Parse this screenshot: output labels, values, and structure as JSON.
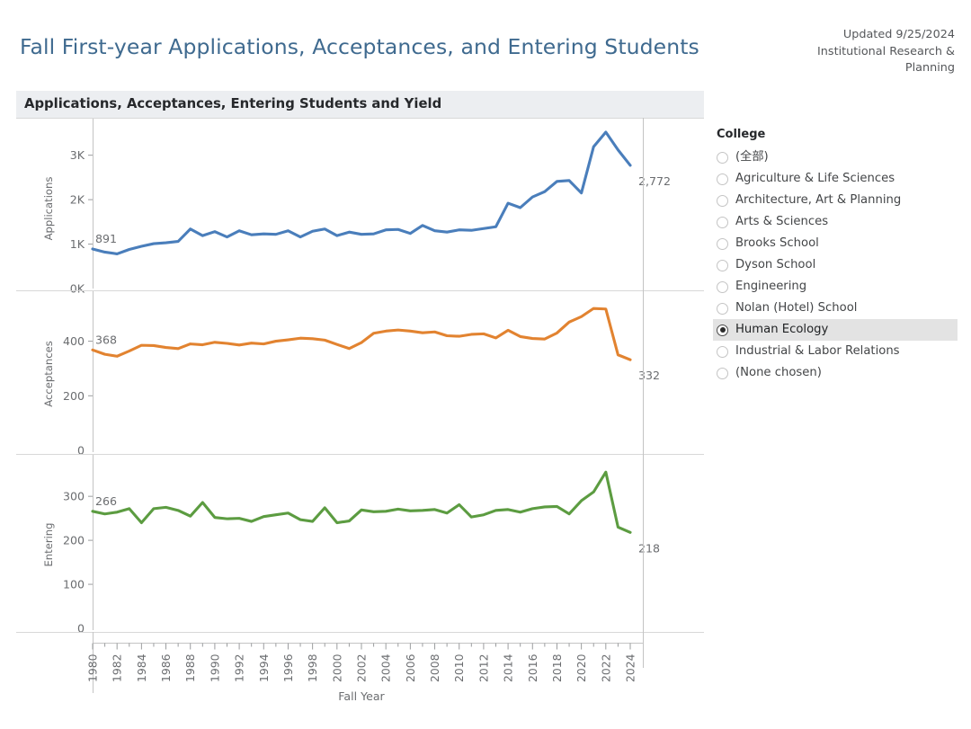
{
  "header": {
    "title": "Fall First-year Applications, Acceptances, and Entering Students",
    "updated": "Updated 9/25/2024",
    "org_line1": "Institutional Research &",
    "org_line2": "Planning"
  },
  "panel": {
    "title": "Applications, Acceptances, Entering Students and Yield"
  },
  "legend": {
    "title": "College",
    "items": [
      {
        "label": "(全部)",
        "selected": false
      },
      {
        "label": "Agriculture & Life Sciences",
        "selected": false
      },
      {
        "label": "Architecture, Art & Planning",
        "selected": false
      },
      {
        "label": "Arts & Sciences",
        "selected": false
      },
      {
        "label": "Brooks School",
        "selected": false
      },
      {
        "label": "Dyson School",
        "selected": false
      },
      {
        "label": "Engineering",
        "selected": false
      },
      {
        "label": "Nolan (Hotel) School",
        "selected": false
      },
      {
        "label": "Human Ecology",
        "selected": true
      },
      {
        "label": "Industrial & Labor Relations",
        "selected": false
      },
      {
        "label": "(None chosen)",
        "selected": false
      }
    ]
  },
  "chart_data": [
    {
      "type": "line",
      "title": "Applications",
      "ylabel": "Applications",
      "xlabel": "Fall Year",
      "color": "#4a7ebb",
      "ylim": [
        0,
        3600
      ],
      "yticks": [
        0,
        1000,
        2000,
        3000
      ],
      "ytick_labels": [
        "0K",
        "1K",
        "2K",
        "3K"
      ],
      "start_label": "891",
      "end_label": "2,772",
      "x": [
        1980,
        1981,
        1982,
        1983,
        1984,
        1985,
        1986,
        1987,
        1988,
        1989,
        1990,
        1991,
        1992,
        1993,
        1994,
        1995,
        1996,
        1997,
        1998,
        1999,
        2000,
        2001,
        2002,
        2003,
        2004,
        2005,
        2006,
        2007,
        2008,
        2009,
        2010,
        2011,
        2012,
        2013,
        2014,
        2015,
        2016,
        2017,
        2018,
        2019,
        2020,
        2021,
        2022,
        2023,
        2024
      ],
      "values": [
        891,
        820,
        780,
        880,
        950,
        1010,
        1030,
        1060,
        1340,
        1190,
        1280,
        1160,
        1300,
        1210,
        1230,
        1220,
        1300,
        1160,
        1290,
        1340,
        1190,
        1270,
        1220,
        1230,
        1320,
        1330,
        1240,
        1420,
        1300,
        1270,
        1320,
        1310,
        1350,
        1390,
        1920,
        1820,
        2060,
        2180,
        2410,
        2430,
        2150,
        3190,
        3520,
        3120,
        2772
      ]
    },
    {
      "type": "line",
      "title": "Acceptances",
      "ylabel": "Acceptances",
      "xlabel": "Fall Year",
      "color": "#e28330",
      "ylim": [
        0,
        560
      ],
      "yticks": [
        0,
        200,
        400
      ],
      "ytick_labels": [
        "0",
        "200",
        "400"
      ],
      "start_label": "368",
      "end_label": "332",
      "x": [
        1980,
        1981,
        1982,
        1983,
        1984,
        1985,
        1986,
        1987,
        1988,
        1989,
        1990,
        1991,
        1992,
        1993,
        1994,
        1995,
        1996,
        1997,
        1998,
        1999,
        2000,
        2001,
        2002,
        2003,
        2004,
        2005,
        2006,
        2007,
        2008,
        2009,
        2010,
        2011,
        2012,
        2013,
        2014,
        2015,
        2016,
        2017,
        2018,
        2019,
        2020,
        2021,
        2022,
        2023,
        2024
      ],
      "values": [
        368,
        352,
        345,
        364,
        385,
        384,
        377,
        373,
        390,
        387,
        396,
        392,
        386,
        393,
        390,
        400,
        405,
        411,
        409,
        404,
        388,
        373,
        395,
        429,
        437,
        441,
        437,
        431,
        434,
        420,
        418,
        425,
        427,
        412,
        440,
        417,
        410,
        408,
        430,
        470,
        490,
        520,
        518,
        350,
        332
      ]
    },
    {
      "type": "line",
      "title": "Entering",
      "ylabel": "Entering",
      "xlabel": "Fall Year",
      "color": "#5c9c41",
      "ylim": [
        0,
        380
      ],
      "yticks": [
        0,
        100,
        200,
        300
      ],
      "ytick_labels": [
        "0",
        "100",
        "200",
        "300"
      ],
      "start_label": "266",
      "end_label": "218",
      "x": [
        1980,
        1981,
        1982,
        1983,
        1984,
        1985,
        1986,
        1987,
        1988,
        1989,
        1990,
        1991,
        1992,
        1993,
        1994,
        1995,
        1996,
        1997,
        1998,
        1999,
        2000,
        2001,
        2002,
        2003,
        2004,
        2005,
        2006,
        2007,
        2008,
        2009,
        2010,
        2011,
        2012,
        2013,
        2014,
        2015,
        2016,
        2017,
        2018,
        2019,
        2020,
        2021,
        2022,
        2023,
        2024
      ],
      "values": [
        266,
        260,
        264,
        272,
        240,
        272,
        275,
        268,
        255,
        286,
        252,
        249,
        250,
        243,
        254,
        258,
        262,
        247,
        243,
        274,
        240,
        244,
        269,
        265,
        266,
        271,
        267,
        268,
        270,
        262,
        281,
        253,
        258,
        268,
        270,
        264,
        272,
        276,
        277,
        260,
        290,
        310,
        355,
        230,
        218
      ]
    }
  ],
  "axis": {
    "xlabel": "Fall Year",
    "xtick_labels": [
      "1980",
      "1982",
      "1984",
      "1986",
      "1988",
      "1990",
      "1992",
      "1994",
      "1996",
      "1998",
      "2000",
      "2002",
      "2004",
      "2006",
      "2008",
      "2010",
      "2012",
      "2014",
      "2016",
      "2018",
      "2020",
      "2022",
      "2024"
    ]
  }
}
